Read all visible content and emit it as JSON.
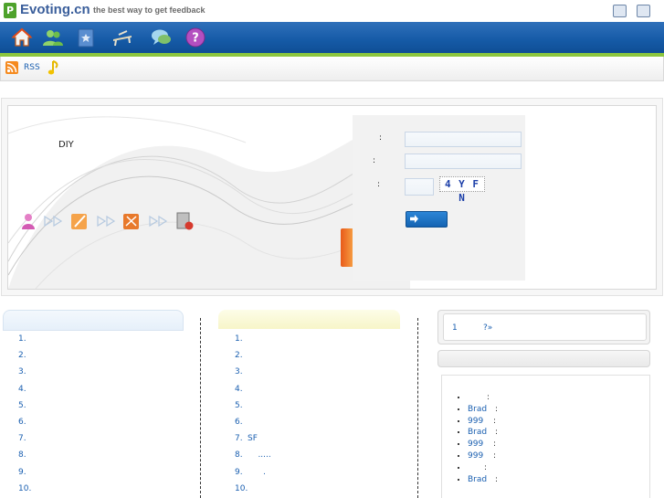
{
  "header": {
    "logo_mark": "P",
    "logo_text": "Evoting.cn",
    "tagline": "the best way to get feedback",
    "top_icons": [
      "print-preview-icon",
      "window-icon"
    ]
  },
  "nav": {
    "icons": [
      "home-icon",
      "users-icon",
      "bookmark-icon",
      "table-tools-icon",
      "chat-icon",
      "help-icon"
    ]
  },
  "subbar": {
    "rss_label": "RSS"
  },
  "hero": {
    "diy_label": "DIY",
    "login": {
      "label1": ":",
      "label2": ":",
      "label3": ":",
      "captcha": "4 Y F N"
    }
  },
  "lists": {
    "left": [
      {
        "num": "1.",
        "text": ""
      },
      {
        "num": "2.",
        "text": ""
      },
      {
        "num": "3.",
        "text": ""
      },
      {
        "num": "4.",
        "text": ""
      },
      {
        "num": "5.",
        "text": ""
      },
      {
        "num": "6.",
        "text": ""
      },
      {
        "num": "7.",
        "text": ""
      },
      {
        "num": "8.",
        "text": ""
      },
      {
        "num": "9.",
        "text": ""
      },
      {
        "num": "10.",
        "text": ""
      }
    ],
    "middle": [
      {
        "num": "1.",
        "text": ""
      },
      {
        "num": "2.",
        "text": ""
      },
      {
        "num": "3.",
        "text": ""
      },
      {
        "num": "4.",
        "text": ""
      },
      {
        "num": "5.",
        "text": ""
      },
      {
        "num": "6.",
        "text": ""
      },
      {
        "num": "7.",
        "text": "SF"
      },
      {
        "num": "8.",
        "text": "    ....."
      },
      {
        "num": "9.",
        "text": "      ."
      },
      {
        "num": "10.",
        "text": ""
      }
    ]
  },
  "right": {
    "poll_number": "1",
    "poll_more": "?»",
    "activity": [
      {
        "user": "",
        "sep": ":"
      },
      {
        "user": "Brad",
        "sep": ":"
      },
      {
        "user": "999",
        "sep": ":"
      },
      {
        "user": "Brad",
        "sep": ":"
      },
      {
        "user": "999",
        "sep": ":"
      },
      {
        "user": "999",
        "sep": ":"
      },
      {
        "user": "",
        "sep": ":"
      },
      {
        "user": "Brad",
        "sep": ":"
      }
    ]
  },
  "colors": {
    "nav_blue": "#155aa6",
    "nav_green_stripe": "#8cc63e",
    "link_blue": "#1a5fb0",
    "left_header": "#eaf3fc",
    "middle_header": "#fbfad6"
  }
}
